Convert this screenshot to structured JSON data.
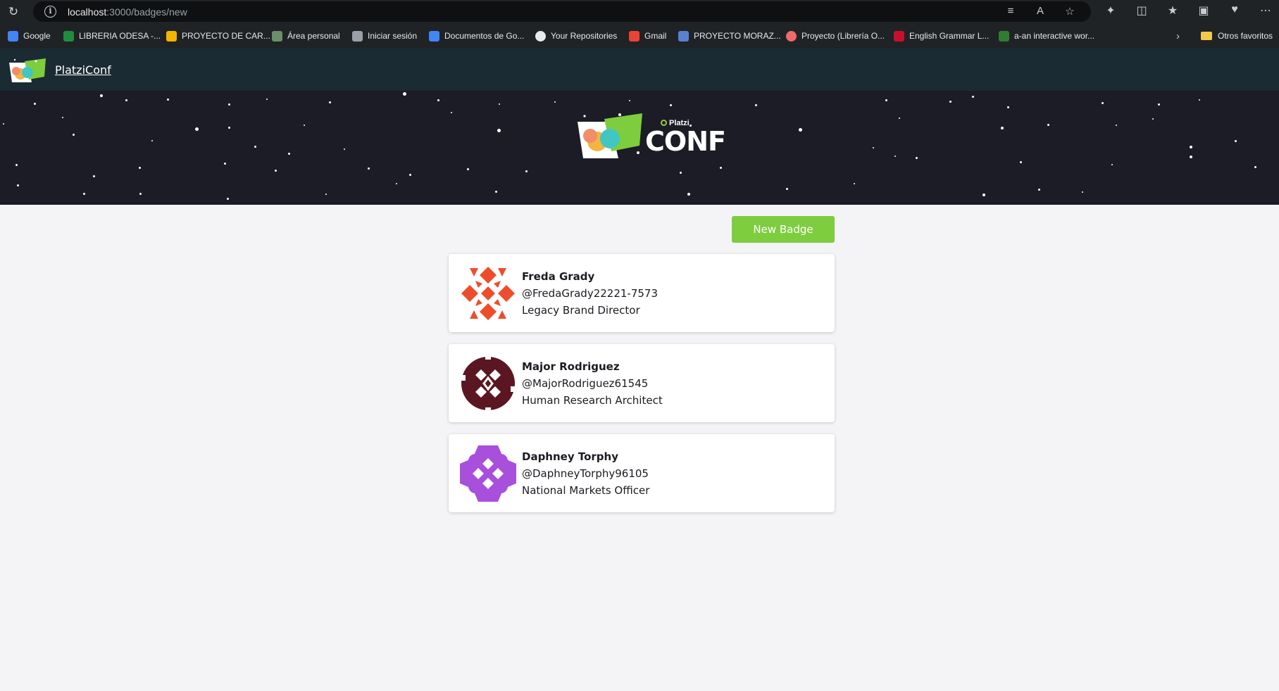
{
  "browser": {
    "url_host": "localhost",
    "url_path": ":3000/badges/new",
    "bookmarks": [
      {
        "label": "Google",
        "color": "#4285f4"
      },
      {
        "label": "LIBRERIA ODESA -...",
        "color": "#1e8e3e"
      },
      {
        "label": "PROYECTO DE CAR...",
        "color": "#f4b400"
      },
      {
        "label": "Área personal",
        "color": "#6b8e6b"
      },
      {
        "label": "Iniciar sesión",
        "color": "#9aa0a6"
      },
      {
        "label": "Documentos de Go...",
        "color": "#4285f4"
      },
      {
        "label": "Your Repositories",
        "color": "#e8eaed"
      },
      {
        "label": "Gmail",
        "color": "#ea4335"
      },
      {
        "label": "PROYECTO MORAZ...",
        "color": "#5b7fd1"
      },
      {
        "label": "Proyecto (Librería O...",
        "color": "#f06a6a"
      },
      {
        "label": "English Grammar L...",
        "color": "#c8102e"
      },
      {
        "label": "a-an interactive wor...",
        "color": "#2e7d32"
      }
    ],
    "other_bookmarks": "Otros favoritos"
  },
  "navbar": {
    "title": "PlatziConf"
  },
  "hero": {
    "brand_top": "Platzi",
    "brand": "CONF"
  },
  "actions": {
    "new_badge_label": "New Badge"
  },
  "badges": [
    {
      "name": "Freda Grady",
      "handle": "@FredaGrady22221-7573",
      "title": "Legacy Brand Director",
      "avatar_color": "#ee4d2c"
    },
    {
      "name": "Major Rodriguez",
      "handle": "@MajorRodriguez61545",
      "title": "Human Research Architect",
      "avatar_color": "#5b1721"
    },
    {
      "name": "Daphney Torphy",
      "handle": "@DaphneyTorphy96105",
      "title": "National Markets Officer",
      "avatar_color": "#a84fdc"
    }
  ],
  "colors": {
    "navbar_bg": "#1b2b33",
    "hero_bg": "#1b1c26",
    "accent_green": "#7dcd3f",
    "page_bg": "#f4f4f6"
  }
}
